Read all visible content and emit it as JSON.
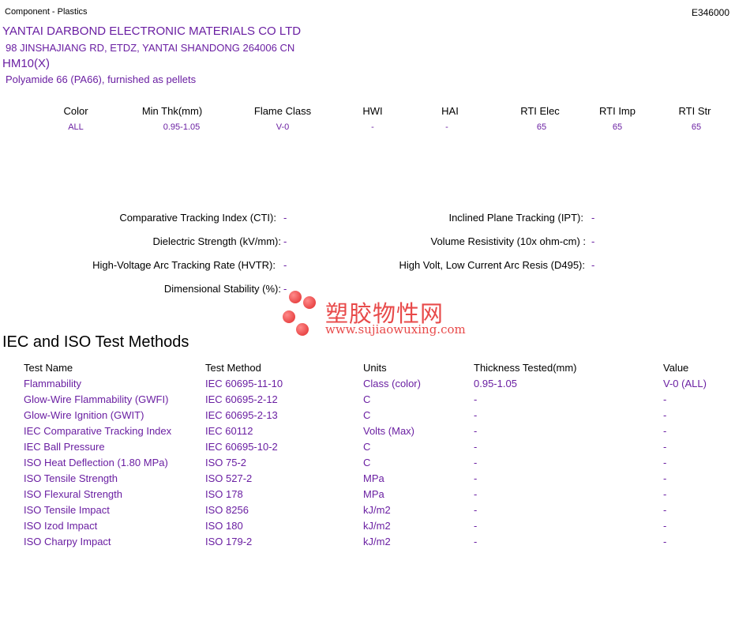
{
  "header": {
    "category": "Component - Plastics",
    "file_number": "E346000"
  },
  "company": {
    "name": "YANTAI DARBOND ELECTRONIC MATERIALS CO LTD",
    "address": "98 JINSHAJIANG RD, ETDZ, YANTAI  SHANDONG  264006 CN"
  },
  "product": {
    "grade": "HM10(X)",
    "description": "Polyamide 66 (PA66), furnished as pellets"
  },
  "properties": {
    "headers": [
      "Color",
      "Min Thk(mm)",
      "Flame Class",
      "HWI",
      "HAI",
      "RTI Elec",
      "RTI Imp",
      "RTI Str"
    ],
    "values": [
      "ALL",
      "0.95-1.05",
      "V-0",
      "-",
      "-",
      "65",
      "65",
      "65"
    ]
  },
  "electrical": {
    "left": [
      {
        "label": "Comparative Tracking Index (CTI):",
        "value": "-"
      },
      {
        "label": "Dielectric Strength (kV/mm):",
        "value": "-"
      },
      {
        "label": "High-Voltage Arc Tracking Rate (HVTR):",
        "value": "-"
      },
      {
        "label": "Dimensional Stability (%):",
        "value": "-"
      }
    ],
    "right": [
      {
        "label": "Inclined Plane Tracking (IPT):",
        "value": "-"
      },
      {
        "label": "Volume Resistivity (10x ohm-cm) :",
        "value": "-"
      },
      {
        "label": "High Volt, Low Current Arc Resis (D495):",
        "value": "-"
      }
    ]
  },
  "watermark": {
    "text_cn": "塑胶物性网",
    "url": "www.sujiaowuxing.com",
    "color": "#e84a4a"
  },
  "iec": {
    "title": "IEC and ISO Test Methods",
    "headers": [
      "Test Name",
      "Test Method",
      "Units",
      "Thickness Tested(mm)",
      "Value"
    ],
    "rows": [
      [
        "Flammability",
        "IEC 60695-11-10",
        "Class (color)",
        "0.95-1.05",
        "V-0 (ALL)"
      ],
      [
        "Glow-Wire Flammability (GWFI)",
        "IEC 60695-2-12",
        "C",
        "-",
        "-"
      ],
      [
        "Glow-Wire Ignition (GWIT)",
        "IEC 60695-2-13",
        "C",
        "-",
        "-"
      ],
      [
        "IEC Comparative Tracking Index",
        "IEC 60112",
        "Volts (Max)",
        "-",
        "-"
      ],
      [
        "IEC Ball Pressure",
        "IEC 60695-10-2",
        "C",
        "-",
        "-"
      ],
      [
        "ISO Heat Deflection (1.80 MPa)",
        "ISO 75-2",
        "C",
        "-",
        "-"
      ],
      [
        "ISO Tensile Strength",
        "ISO 527-2",
        "MPa",
        "-",
        "-"
      ],
      [
        "ISO Flexural Strength",
        "ISO 178",
        "MPa",
        "-",
        "-"
      ],
      [
        "ISO Tensile Impact",
        "ISO 8256",
        "kJ/m2",
        "-",
        "-"
      ],
      [
        "ISO Izod Impact",
        "ISO 180",
        "kJ/m2",
        "-",
        "-"
      ],
      [
        "ISO Charpy Impact",
        "ISO 179-2",
        "kJ/m2",
        "-",
        "-"
      ]
    ]
  },
  "colors": {
    "value_text": "#6a1fa2",
    "label_text": "#000000"
  }
}
